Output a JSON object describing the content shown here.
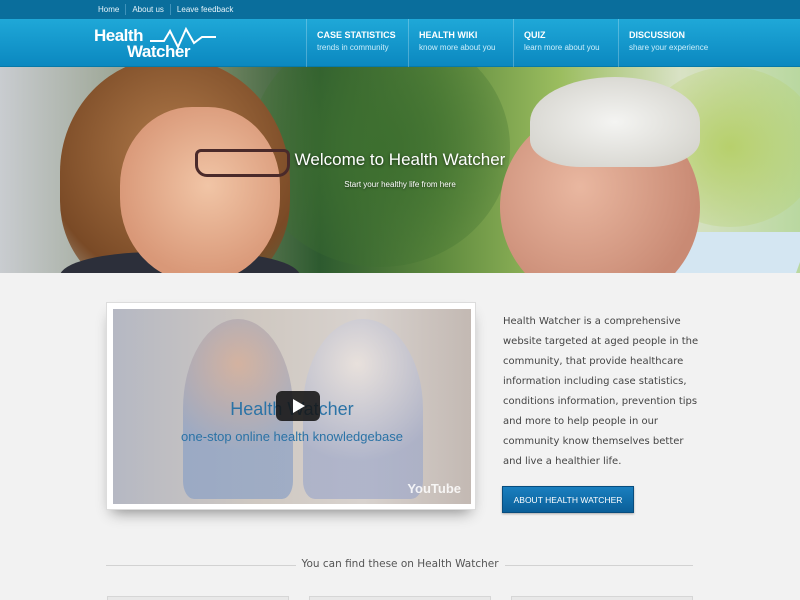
{
  "topbar": {
    "links": [
      "Home",
      "About us",
      "Leave feedback"
    ]
  },
  "header": {
    "logo": {
      "line1": "Health",
      "line2": "Watcher"
    },
    "nav": [
      {
        "title": "CASE STATISTICS",
        "subtitle": "trends in community"
      },
      {
        "title": "HEALTH WIKI",
        "subtitle": "know more about you"
      },
      {
        "title": "QUIZ",
        "subtitle": "learn more about you"
      },
      {
        "title": "DISCUSSION",
        "subtitle": "share your experience"
      }
    ]
  },
  "hero": {
    "title": "Welcome to Health Watcher",
    "subtitle": "Start your healthy life from here"
  },
  "video": {
    "line1": "Health Watcher",
    "line2": "one-stop online health knowledgebase",
    "watermark": "YouTube"
  },
  "about": {
    "text": "Health Watcher is a comprehensive website targeted at aged people in the community, that provide healthcare information including case statistics, conditions information, prevention tips and more to help people in our community know themselves better and live a healthier life.",
    "button": "ABOUT HEALTH WATCHER"
  },
  "features": {
    "title": "You can find these on Health Watcher"
  },
  "colors": {
    "primary": "#0b88c0",
    "topbar": "#0a6e9c",
    "button": "#0a5f99"
  }
}
